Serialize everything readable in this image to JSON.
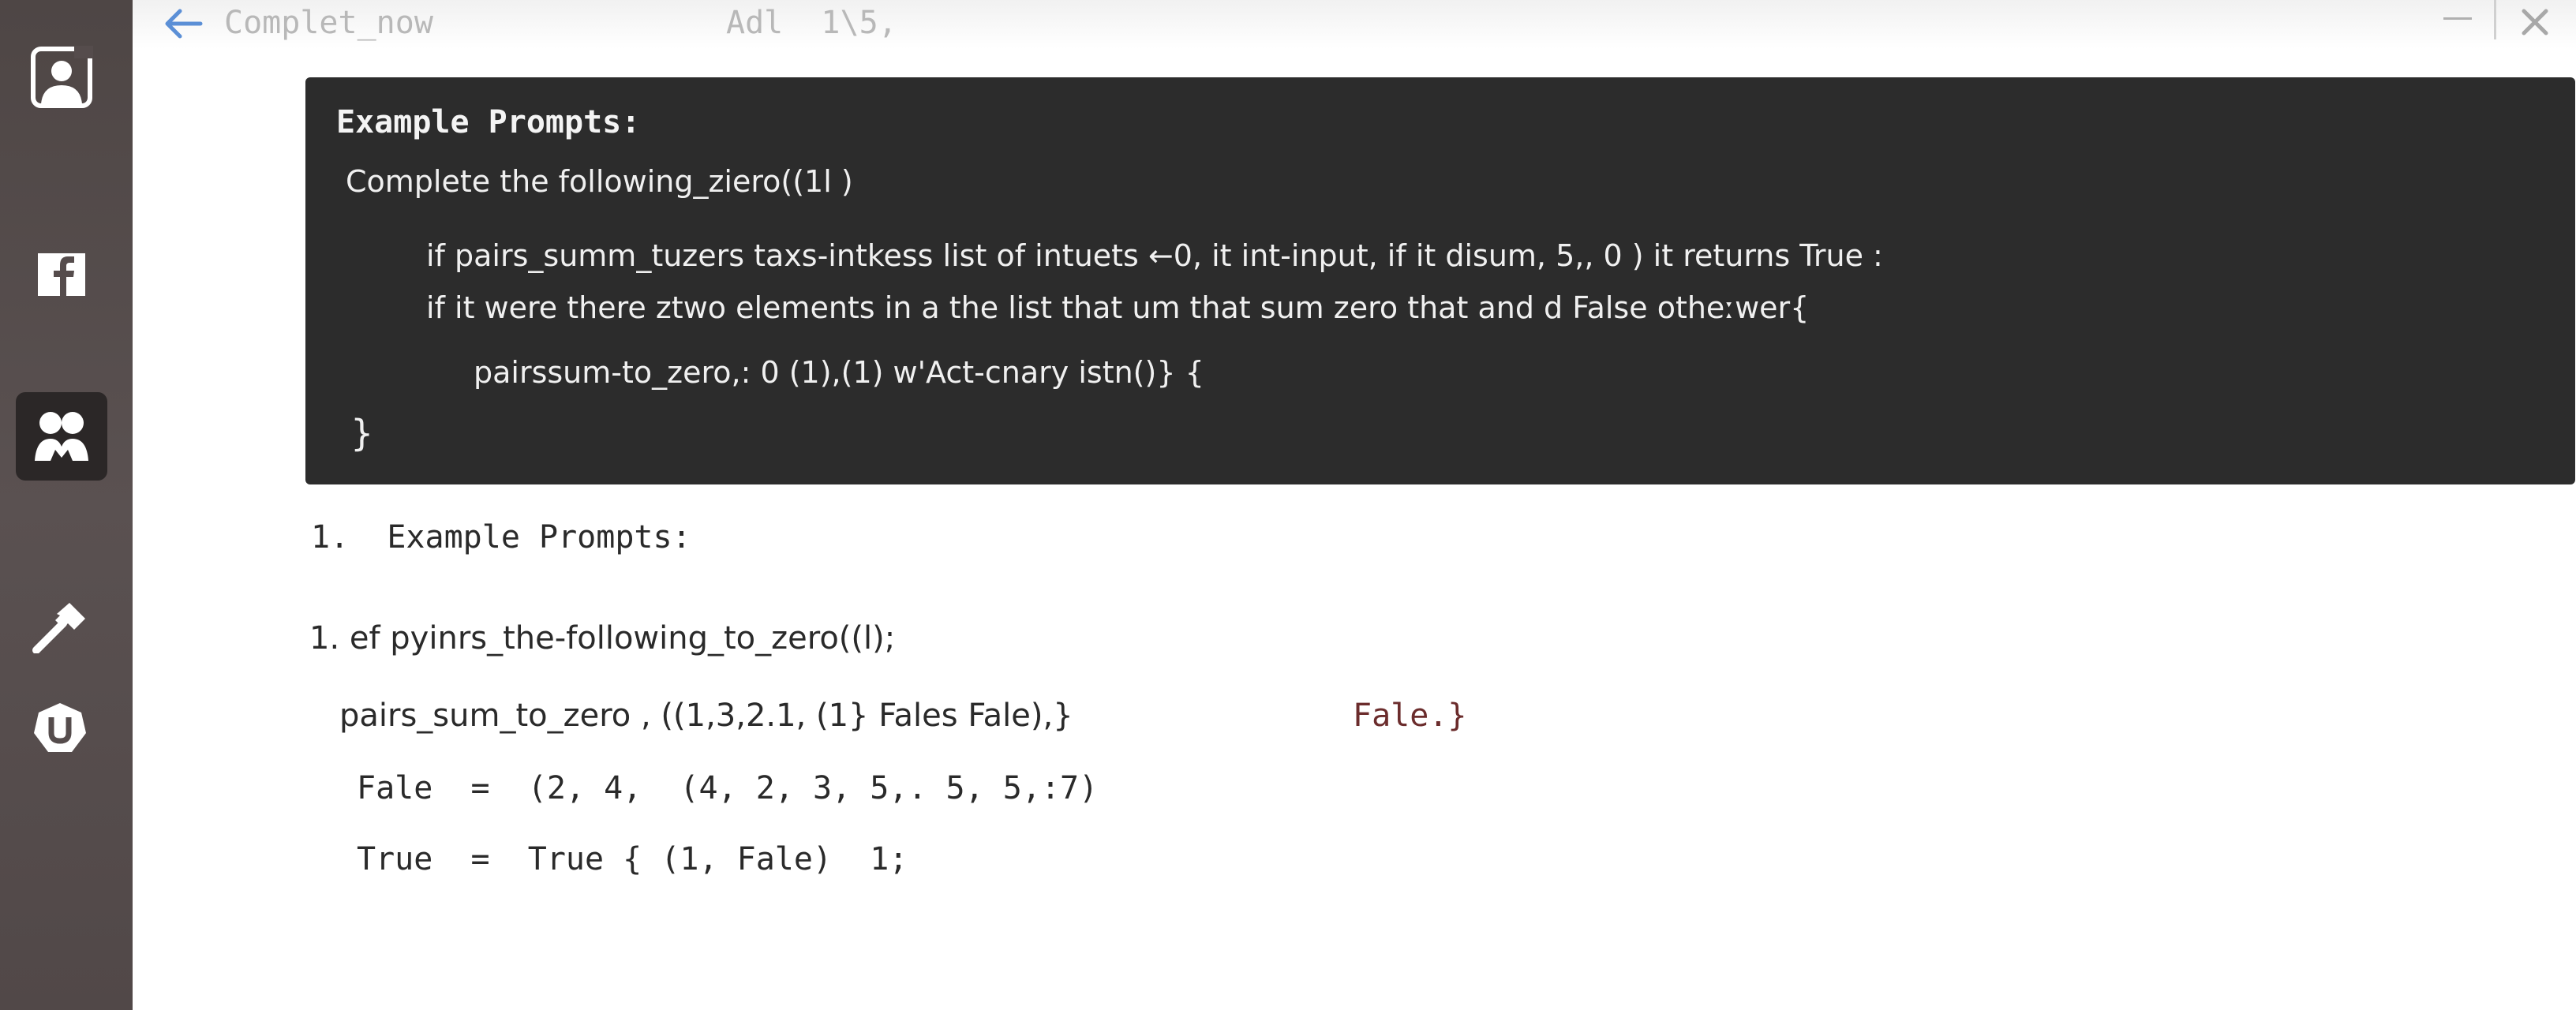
{
  "window": {
    "title": "Complet_now",
    "title_extra": "Adl  1\\5,"
  },
  "sidebar": {
    "icons": [
      {
        "name": "profile-icon"
      },
      {
        "name": "facebook-icon"
      },
      {
        "name": "users-icon",
        "active": true
      },
      {
        "name": "hammer-icon"
      },
      {
        "name": "u-badge-icon"
      }
    ]
  },
  "code_block": {
    "heading": "Example Prompts:",
    "line1": "Complete the following_ziero((1l )",
    "line2": "if pairs_summ_tuzers taxs-intkess list of intuets ←0, it int-input, if it disum, 5,, 0 ) it returns True :",
    "line3": "if it were there ztwo elements in a the list that um that sum zero that and d False otheːwer{",
    "line4": "pairssum-to_zero,: 0 (1),(1) w'Act-cnary istn()} {",
    "line5": "}"
  },
  "content": {
    "section_heading": "1.  Example Prompts:",
    "item1": "1. ef pyinrs_the-following_to_zero((l);",
    "example1": "pairs_sum_to_zero , ((1,3,2.1, (1} Fales Fale),}",
    "example1_result": "Fale.}",
    "example2": "Fale  =  (2, 4,  (4, 2, 3, 5,. 5, 5,:7)",
    "example3": "True  =  True { (1, Fale)  1;"
  },
  "colors": {
    "sidebar": "#554c4c",
    "code_bg": "#2c2c2c",
    "accent": "#6b2c2c",
    "back_arrow": "#5b8fd6"
  }
}
